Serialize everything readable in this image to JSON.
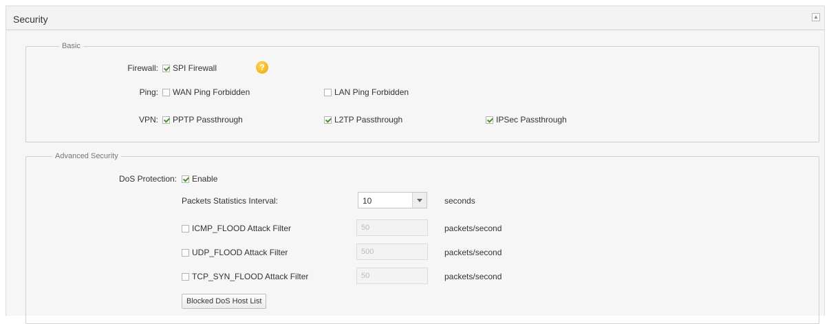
{
  "panel": {
    "title": "Security",
    "collapse_icon": "collapse-icon"
  },
  "basic": {
    "legend": "Basic",
    "firewall": {
      "label": "Firewall:",
      "spi": {
        "label": "SPI Firewall",
        "checked": true
      },
      "help_icon": "help-icon"
    },
    "ping": {
      "label": "Ping:",
      "wan": {
        "label": "WAN Ping Forbidden",
        "checked": false
      },
      "lan": {
        "label": "LAN Ping Forbidden",
        "checked": false
      }
    },
    "vpn": {
      "label": "VPN:",
      "pptp": {
        "label": "PPTP Passthrough",
        "checked": true
      },
      "l2tp": {
        "label": "L2TP Passthrough",
        "checked": true
      },
      "ipsec": {
        "label": "IPSec Passthrough",
        "checked": true
      }
    }
  },
  "advanced": {
    "legend": "Advanced Security",
    "dos": {
      "label": "DoS Protection:",
      "enable": {
        "label": "Enable",
        "checked": true
      }
    },
    "interval": {
      "label": "Packets Statistics Interval:",
      "value": "10",
      "unit": "seconds"
    },
    "filters": [
      {
        "label": "ICMP_FLOOD Attack Filter",
        "checked": false,
        "value": "50",
        "unit": "packets/second"
      },
      {
        "label": "UDP_FLOOD Attack Filter",
        "checked": false,
        "value": "500",
        "unit": "packets/second"
      },
      {
        "label": "TCP_SYN_FLOOD Attack Filter",
        "checked": false,
        "value": "50",
        "unit": "packets/second"
      }
    ],
    "blocked_button": "Blocked DoS Host List"
  }
}
